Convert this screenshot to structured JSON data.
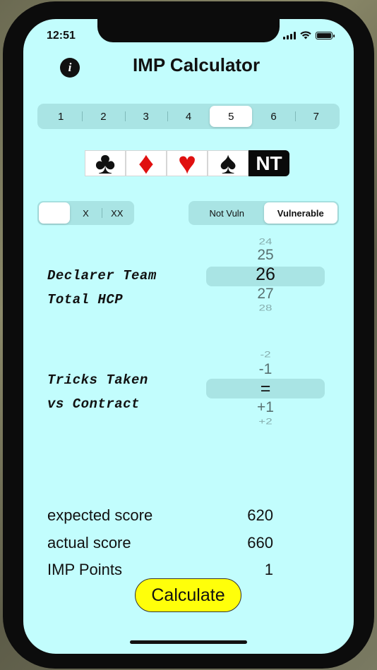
{
  "status_bar": {
    "time": "12:51"
  },
  "header": {
    "title": "IMP Calculator",
    "info_icon": "info-icon"
  },
  "level_selector": {
    "options": [
      "1",
      "2",
      "3",
      "4",
      "5",
      "6",
      "7"
    ],
    "selected_index": 4
  },
  "suits": {
    "items": [
      {
        "glyph": "♣",
        "name": "clubs",
        "color": "#111111"
      },
      {
        "glyph": "♦",
        "name": "diamonds",
        "color": "#e01010"
      },
      {
        "glyph": "♥",
        "name": "hearts",
        "color": "#e01010"
      },
      {
        "glyph": "♠",
        "name": "spades",
        "color": "#111111"
      },
      {
        "glyph": "NT",
        "name": "no-trump",
        "color": "#ffffff"
      }
    ]
  },
  "doubled_selector": {
    "options": [
      "",
      "X",
      "XX"
    ],
    "selected_index": 0
  },
  "vulnerability_selector": {
    "options": [
      "Not Vuln",
      "Vulnerable"
    ],
    "selected_index": 1
  },
  "hcp": {
    "label_line1": "Declarer Team",
    "label_line2": "Total HCP",
    "picker_values": [
      "24",
      "25",
      "26",
      "27",
      "28"
    ],
    "selected": "26"
  },
  "tricks": {
    "label_line1": "Tricks Taken",
    "label_line2": "vs Contract",
    "picker_values": [
      "-2",
      "-1",
      "=",
      "+1",
      "+2"
    ],
    "selected": "="
  },
  "results": {
    "expected_label": "expected score",
    "expected_value": "620",
    "actual_label": "actual score",
    "actual_value": "660",
    "imp_label": "IMP Points",
    "imp_value": "1"
  },
  "calculate_button": {
    "label": "Calculate"
  },
  "colors": {
    "background": "#c2fdfd",
    "segment_track": "#a9e4e4",
    "button": "#ffff0a",
    "red_suit": "#e01010"
  }
}
